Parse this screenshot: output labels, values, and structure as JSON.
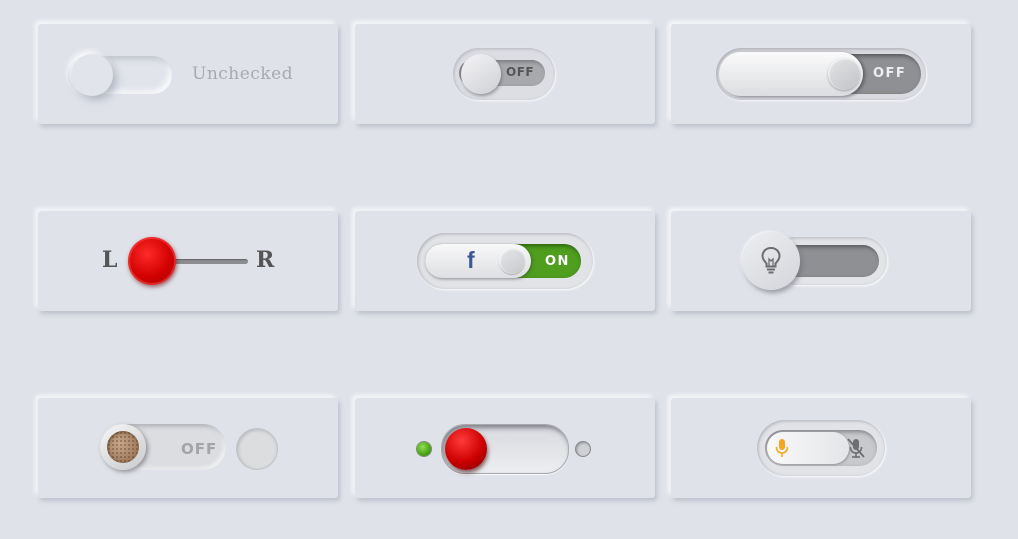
{
  "toggles": {
    "t1": {
      "label": "Unchecked",
      "state": "off"
    },
    "t2": {
      "label": "OFF",
      "state": "off"
    },
    "t3": {
      "label": "OFF",
      "state": "off"
    },
    "t4": {
      "left_label": "L",
      "right_label": "R",
      "state": "left"
    },
    "t5": {
      "icon_text": "f",
      "label": "ON",
      "state": "on"
    },
    "t6": {
      "icon": "lightbulb-icon",
      "state": "off"
    },
    "t7": {
      "label": "OFF",
      "state": "off"
    },
    "t8": {
      "left_indicator": "green",
      "right_indicator": "gray",
      "state": "left"
    },
    "t9": {
      "left_icon": "microphone-icon",
      "right_icon": "microphone-muted-icon",
      "state": "on"
    }
  },
  "colors": {
    "background": "#dfe2e9",
    "red_knob": "#d20000",
    "green_on": "#4f9e1e",
    "facebook_blue": "#3b5998",
    "mic_orange": "#f5a623"
  }
}
